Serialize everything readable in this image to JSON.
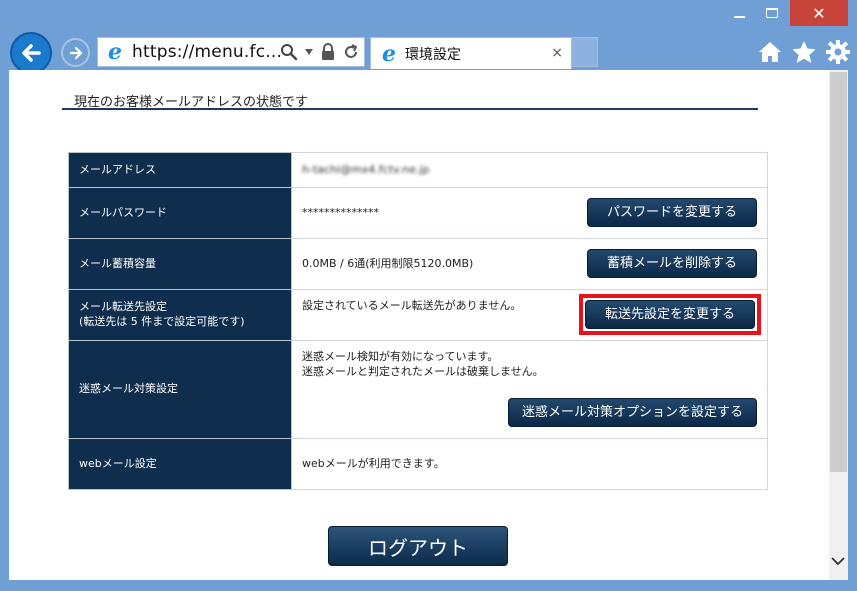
{
  "browser": {
    "window_controls": {
      "minimize": "–",
      "close": "✕"
    },
    "url": "https://menu.fc...",
    "tab_title": "環境設定",
    "tab_close": "×",
    "ie_glyph": "e"
  },
  "page": {
    "heading": "現在のお客様メールアドレスの状態です",
    "rows": [
      {
        "label": "メールアドレス",
        "value": "h-tachi@mx4.fctv.ne.jp"
      },
      {
        "label": "メールパスワード",
        "value": "**************",
        "button": "パスワードを変更する"
      },
      {
        "label": "メール蓄積容量",
        "value": "0.0MB / 6通(利用制限5120.0MB)",
        "button": "蓄積メールを削除する"
      },
      {
        "label_line1": "メール転送先設定",
        "label_line2": "(転送先は 5 件まで設定可能です)",
        "value": "設定されているメール転送先がありません。",
        "button": "転送先設定を変更する"
      },
      {
        "label": "迷惑メール対策設定",
        "value_line1": "迷惑メール検知が有効になっています。",
        "value_line2": "迷惑メールと判定されたメールは破棄しません。",
        "button": "迷惑メール対策オプションを設定する"
      },
      {
        "label": "webメール設定",
        "value": "webメールが利用できます。"
      }
    ],
    "logout": "ログアウト"
  },
  "icons": {
    "back": "back-arrow-icon",
    "forward": "forward-arrow-icon",
    "search": "search-icon",
    "lock": "lock-icon",
    "refresh": "refresh-icon",
    "home": "home-icon",
    "favorites": "star-icon",
    "settings": "gear-icon"
  },
  "colors": {
    "label_bg": "#0f2d4c",
    "button_bg": "#0b2848",
    "highlight": "#e8121a",
    "chrome": "#6f9fd5"
  }
}
